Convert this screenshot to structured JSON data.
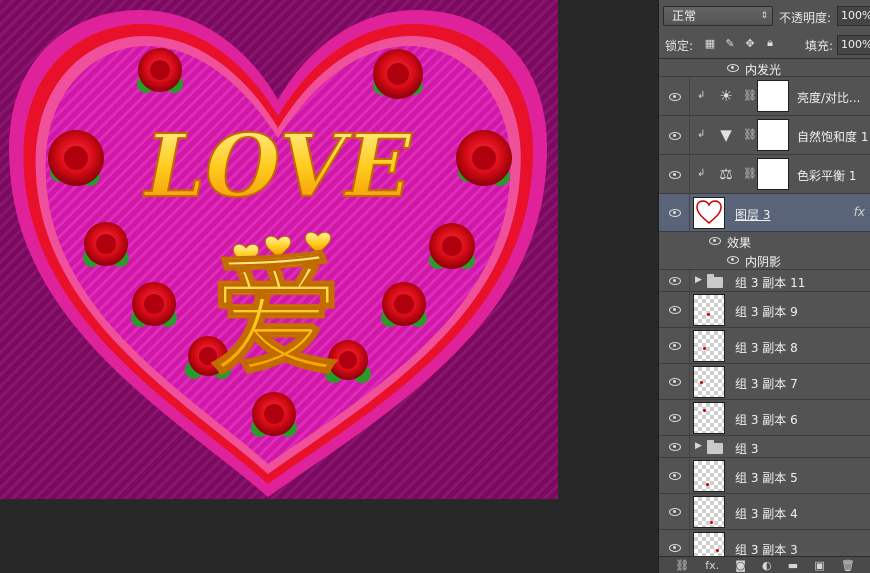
{
  "layers_panel": {
    "blend_mode": "正常",
    "opacity_label": "不透明度:",
    "opacity_value": "100%",
    "lock_label": "锁定:",
    "fill_label": "填充:",
    "fill_value": "100%",
    "lock_icons": [
      "lock-transparent-icon",
      "lock-paint-icon",
      "lock-move-icon",
      "lock-all-icon"
    ],
    "effect_inner_glow": "内发光",
    "adjustment_layers": [
      {
        "name": "亮度/对比...",
        "icon": "brightness-icon"
      },
      {
        "name": "自然饱和度 1",
        "icon": "vibrance-icon"
      },
      {
        "name": "色彩平衡 1",
        "icon": "color-balance-icon"
      }
    ],
    "selected_layer": {
      "name": "图层 3",
      "fx": "fx"
    },
    "effects_label": "效果",
    "effect_inner_shadow": "内阴影",
    "group_1": "组 3 副本 11",
    "copies_a": [
      "组 3 副本 9",
      "组 3 副本 8",
      "组 3 副本 7",
      "组 3 副本 6"
    ],
    "group_2": "组 3",
    "copies_b": [
      "组 3 副本 5",
      "组 3 副本 4",
      "组 3 副本 3"
    ],
    "bottom_icons": [
      "link-icon",
      "fx-icon",
      "mask-icon",
      "adjustment-icon",
      "folder-icon",
      "new-layer-icon",
      "trash-icon"
    ],
    "bottom_fx": "fx."
  },
  "artwork": {
    "title_text": "LOVE",
    "love_char": "爱",
    "colors": {
      "background": "#7a0a5e",
      "heart_outer": "#e0229a",
      "heart_rim": "#e8102a",
      "heart_inner": "#d018a8",
      "gold": "#ffd23c",
      "rose": "#d40a16",
      "leaf": "#2a9a2a"
    }
  }
}
